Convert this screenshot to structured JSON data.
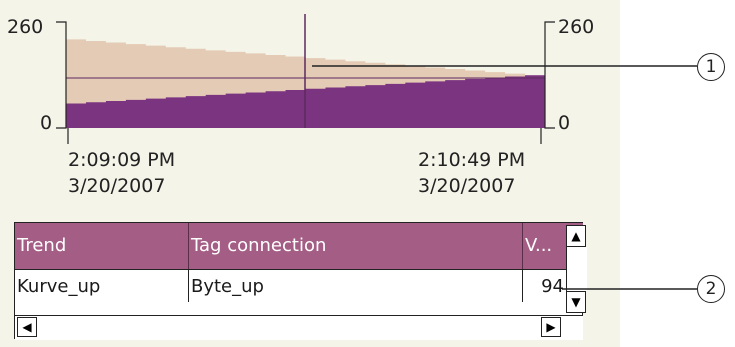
{
  "trend_view": {
    "y_axis_left": {
      "max": "260",
      "min": "0"
    },
    "y_axis_right": {
      "max": "260",
      "min": "0"
    },
    "time_start": {
      "time": "2:09:09 PM",
      "date": "3/20/2007"
    },
    "time_end": {
      "time": "2:10:49 PM",
      "date": "3/20/2007"
    },
    "colors": {
      "background": "#f5f4e9",
      "upper_band": "#e4cbb5",
      "lower_band": "#7b3580",
      "cursor": "#5c2a5e"
    }
  },
  "chart_data": {
    "type": "area",
    "x": [
      "2:09:09 PM",
      "2:10:49 PM"
    ],
    "ylim": [
      0,
      260
    ],
    "series": [
      {
        "values": [
          235,
          140
        ]
      },
      {
        "values": [
          65,
          140
        ]
      }
    ]
  },
  "value_table": {
    "headers": {
      "trend": "Trend",
      "tag_connection": "Tag connection",
      "value": "V..."
    },
    "rows": [
      {
        "trend": "Kurve_up",
        "tag_connection": "Byte_up",
        "value": "94"
      }
    ],
    "header_color": "#a45e85"
  },
  "scroll": {
    "up_icon": "arrow-up-icon",
    "down_icon": "arrow-down-icon",
    "left_icon": "arrow-left-icon",
    "right_icon": "arrow-right-icon"
  },
  "callouts": {
    "ruler": "1",
    "value_column": "2"
  }
}
